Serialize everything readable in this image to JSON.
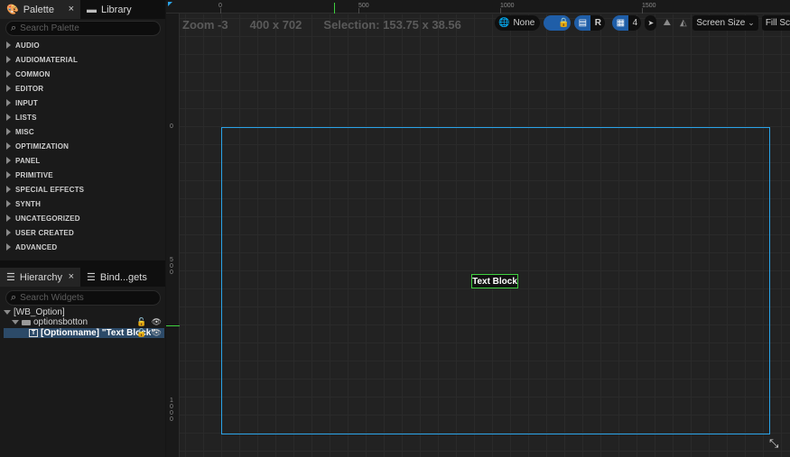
{
  "palette": {
    "tab_label": "Palette",
    "close_label": "×",
    "library_tab_label": "Library",
    "search_placeholder": "Search Palette",
    "categories": [
      "AUDIO",
      "AUDIOMATERIAL",
      "COMMON",
      "EDITOR",
      "INPUT",
      "LISTS",
      "MISC",
      "OPTIMIZATION",
      "PANEL",
      "PRIMITIVE",
      "SPECIAL EFFECTS",
      "SYNTH",
      "UNCATEGORIZED",
      "USER CREATED",
      "ADVANCED"
    ]
  },
  "hierarchy": {
    "tab_label": "Hierarchy",
    "close_label": "×",
    "bindings_tab_label": "Bind...gets",
    "search_placeholder": "Search Widgets",
    "root_label": "[WB_Option]",
    "child_label": "optionsbotton",
    "grandchild_label": "[Optionname] \"Text Block\""
  },
  "designer": {
    "zoom_label": "Zoom -3",
    "size_label": "400 x 702",
    "selection_label": "Selection: 153.75 x 38.56",
    "localization_label": "None",
    "r_button_label": "R",
    "grid_snap_value": "4",
    "screen_size_label": "Screen Size",
    "fill_screen_label": "Fill Screen",
    "text_block_label": "Text Block",
    "ruler_top": [
      "0",
      "500",
      "1000",
      "1500"
    ],
    "ruler_left": [
      "0",
      "5\n0\n0",
      "1\n0\n0\n0"
    ]
  },
  "colors": {
    "selection_blue": "#2aa3e8",
    "widget_outline_green": "#3fd13f",
    "accent_button_blue": "#1f5ea8"
  }
}
